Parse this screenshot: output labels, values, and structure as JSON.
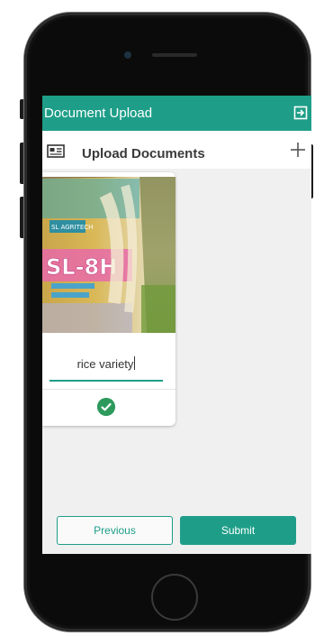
{
  "app": {
    "header_title": "Document Upload",
    "section_title": "Upload Documents"
  },
  "icons": {
    "logout": "logout-icon",
    "section": "id-card-icon",
    "add": "plus-icon",
    "verified": "check-circle-icon"
  },
  "document": {
    "image_label": "SL-8H",
    "caption_value": "rice variety",
    "status": "verified"
  },
  "actions": {
    "previous_label": "Previous",
    "submit_label": "Submit"
  },
  "colors": {
    "accent": "#1e9e88",
    "success": "#2d9a5c"
  }
}
